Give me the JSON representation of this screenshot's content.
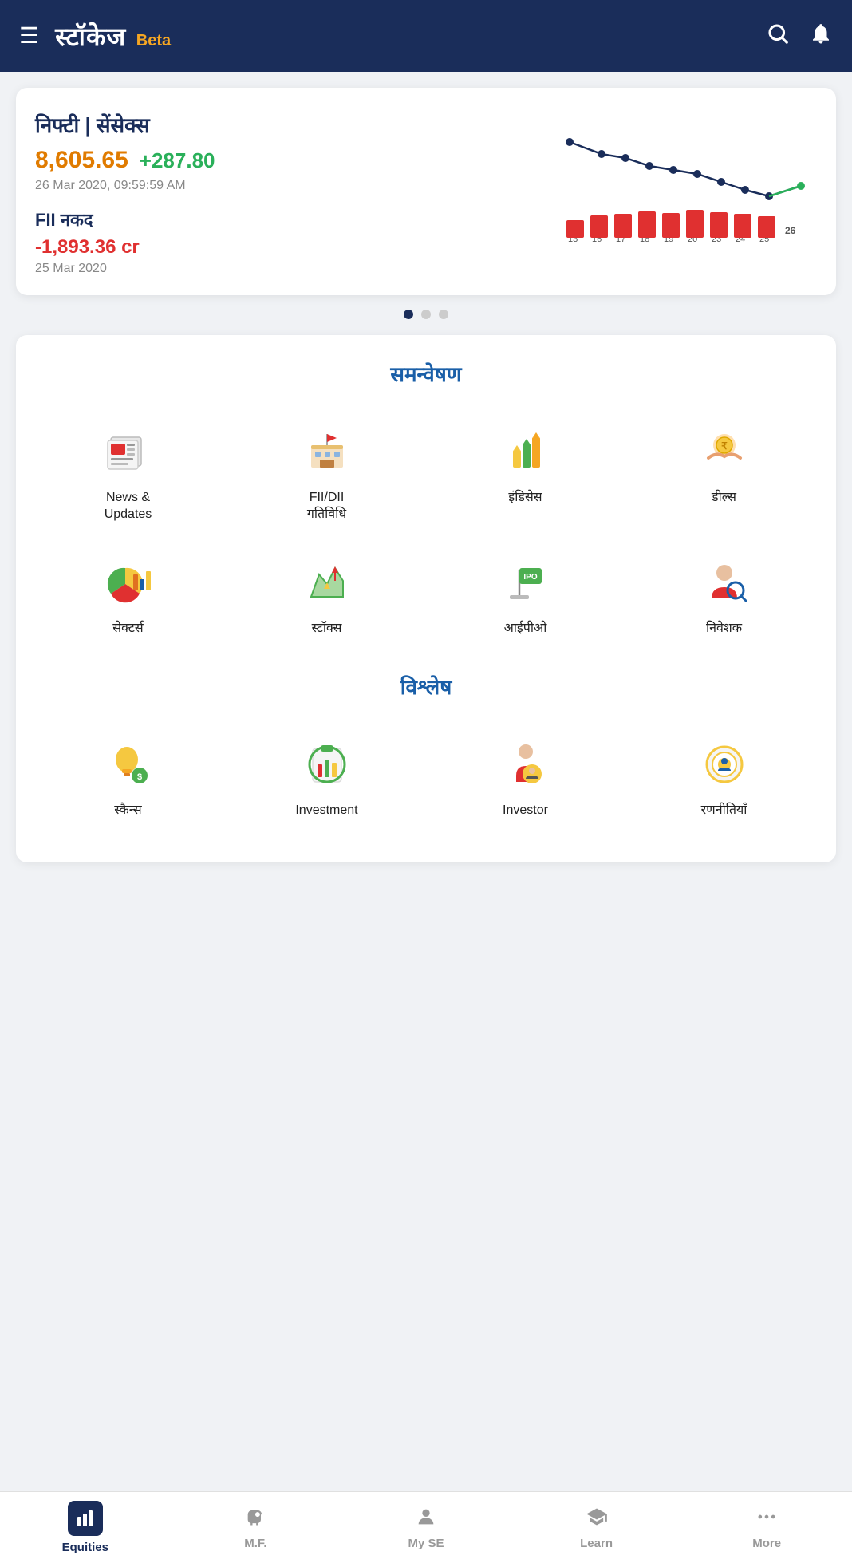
{
  "header": {
    "title": "स्टॉकेज",
    "beta_label": "Beta",
    "search_icon": "search-icon",
    "bell_icon": "bell-icon",
    "menu_icon": "menu-icon"
  },
  "market_card": {
    "title": "निफ्टी | सेंसेक्स",
    "price": "8,605.65",
    "change": "+287.80",
    "datetime": "26 Mar 2020, 09:59:59 AM",
    "fii_label": "FII नकद",
    "fii_value": "-1,893.36 cr",
    "fii_date": "25 Mar 2020",
    "chart_labels": [
      "13",
      "16",
      "17",
      "18",
      "19",
      "20",
      "23",
      "24",
      "25",
      "26"
    ]
  },
  "dots": {
    "active_index": 0,
    "count": 3
  },
  "samanveshan": {
    "heading": "समन्वेषण",
    "items": [
      {
        "label": "News &\nUpdates",
        "icon": "newspaper-icon"
      },
      {
        "label": "FII/DII\nगतिविधि",
        "icon": "building-icon"
      },
      {
        "label": "इंडिसेस",
        "icon": "indices-icon"
      },
      {
        "label": "डील्स",
        "icon": "deals-icon"
      },
      {
        "label": "सेक्टर्स",
        "icon": "sectors-icon"
      },
      {
        "label": "स्टॉक्स",
        "icon": "stocks-icon"
      },
      {
        "label": "आईपीओ",
        "icon": "ipo-icon"
      },
      {
        "label": "निवेशक",
        "icon": "investor-icon"
      }
    ]
  },
  "vishleshan": {
    "heading": "विश्लेष",
    "items": [
      {
        "label": "स्कैन्स",
        "icon": "scans-icon"
      },
      {
        "label": "Investment",
        "icon": "investment-icon"
      },
      {
        "label": "Investor",
        "icon": "investor2-icon"
      },
      {
        "label": "रणनीतियाँ",
        "icon": "strategy-icon"
      }
    ]
  },
  "bottom_nav": {
    "items": [
      {
        "label": "Equities",
        "icon": "chart-bar-icon",
        "active": true
      },
      {
        "label": "M.F.",
        "icon": "piggy-icon",
        "active": false
      },
      {
        "label": "My SE",
        "icon": "person-icon",
        "active": false
      },
      {
        "label": "Learn",
        "icon": "graduation-icon",
        "active": false
      },
      {
        "label": "More",
        "icon": "dots-icon",
        "active": false
      }
    ]
  }
}
